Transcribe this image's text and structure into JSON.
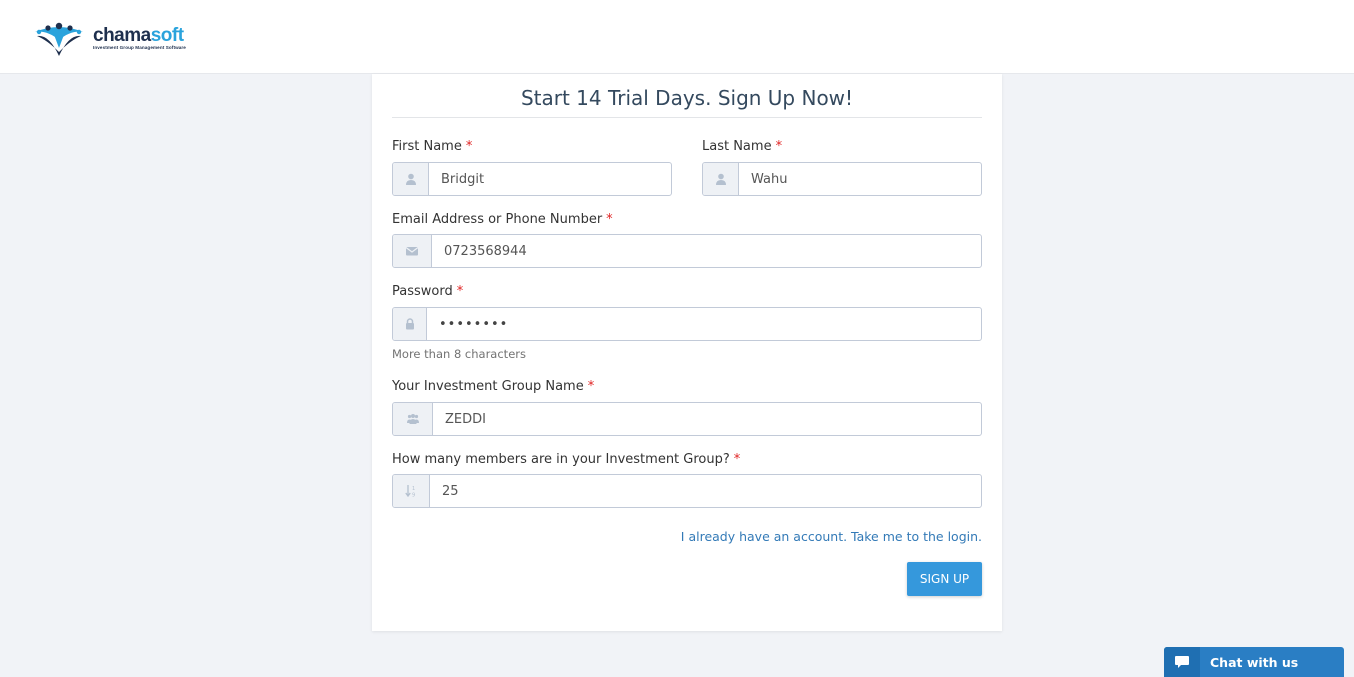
{
  "brand": {
    "name_part1": "chama",
    "name_part2": "soft",
    "tagline": "Investment Group Management Software",
    "primary_color": "#1e2f4d",
    "accent_color": "#2aa3dc"
  },
  "form": {
    "title": "Start 14 Trial Days. Sign Up Now!",
    "required_marker": "*",
    "first_name": {
      "label": "First Name",
      "value": "Bridgit",
      "icon": "user-icon"
    },
    "last_name": {
      "label": "Last Name",
      "value": "Wahu",
      "icon": "user-icon"
    },
    "email_phone": {
      "label": "Email Address or Phone Number",
      "value": "0723568944",
      "icon": "envelope-icon"
    },
    "password": {
      "label": "Password",
      "value": "••••••••",
      "help": "More than 8 characters",
      "icon": "lock-icon"
    },
    "group_name": {
      "label": "Your Investment Group Name",
      "value": "ZEDDI",
      "icon": "users-icon"
    },
    "members": {
      "label": "How many members are in your Investment Group?",
      "value": "25",
      "icon": "numeric-sort-icon"
    },
    "login_link": "I already have an account. Take me to the login.",
    "submit_label": "SIGN UP",
    "submit_color": "#3598dc"
  },
  "chat": {
    "label": "Chat with us",
    "icon": "chat-bubble-icon",
    "color": "#2a7ec4"
  }
}
